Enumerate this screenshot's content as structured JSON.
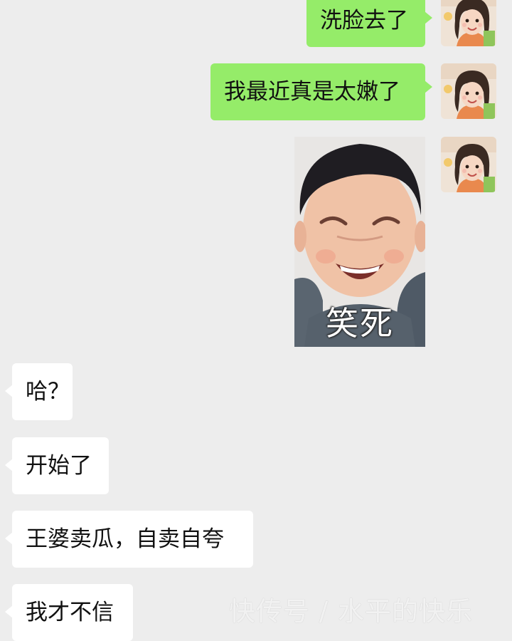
{
  "colors": {
    "chat_background": "#ededed",
    "outgoing_bubble": "#95ec69",
    "incoming_bubble": "#ffffff",
    "message_text": "#111111"
  },
  "outgoing_messages": [
    {
      "text": "洗脸去了"
    },
    {
      "text": "我最近真是太嫩了"
    }
  ],
  "sticker": {
    "caption": "笑死",
    "icon": "laughing-toddler-sticker"
  },
  "incoming_messages": [
    {
      "text": "哈？"
    },
    {
      "text": "开始了"
    },
    {
      "text": "王婆卖瓜，自卖自夸"
    },
    {
      "text": "我才不信"
    }
  ],
  "avatar": {
    "icon": "little-girl-avatar"
  },
  "watermark": {
    "text": "快传号 / 水平的快乐"
  }
}
